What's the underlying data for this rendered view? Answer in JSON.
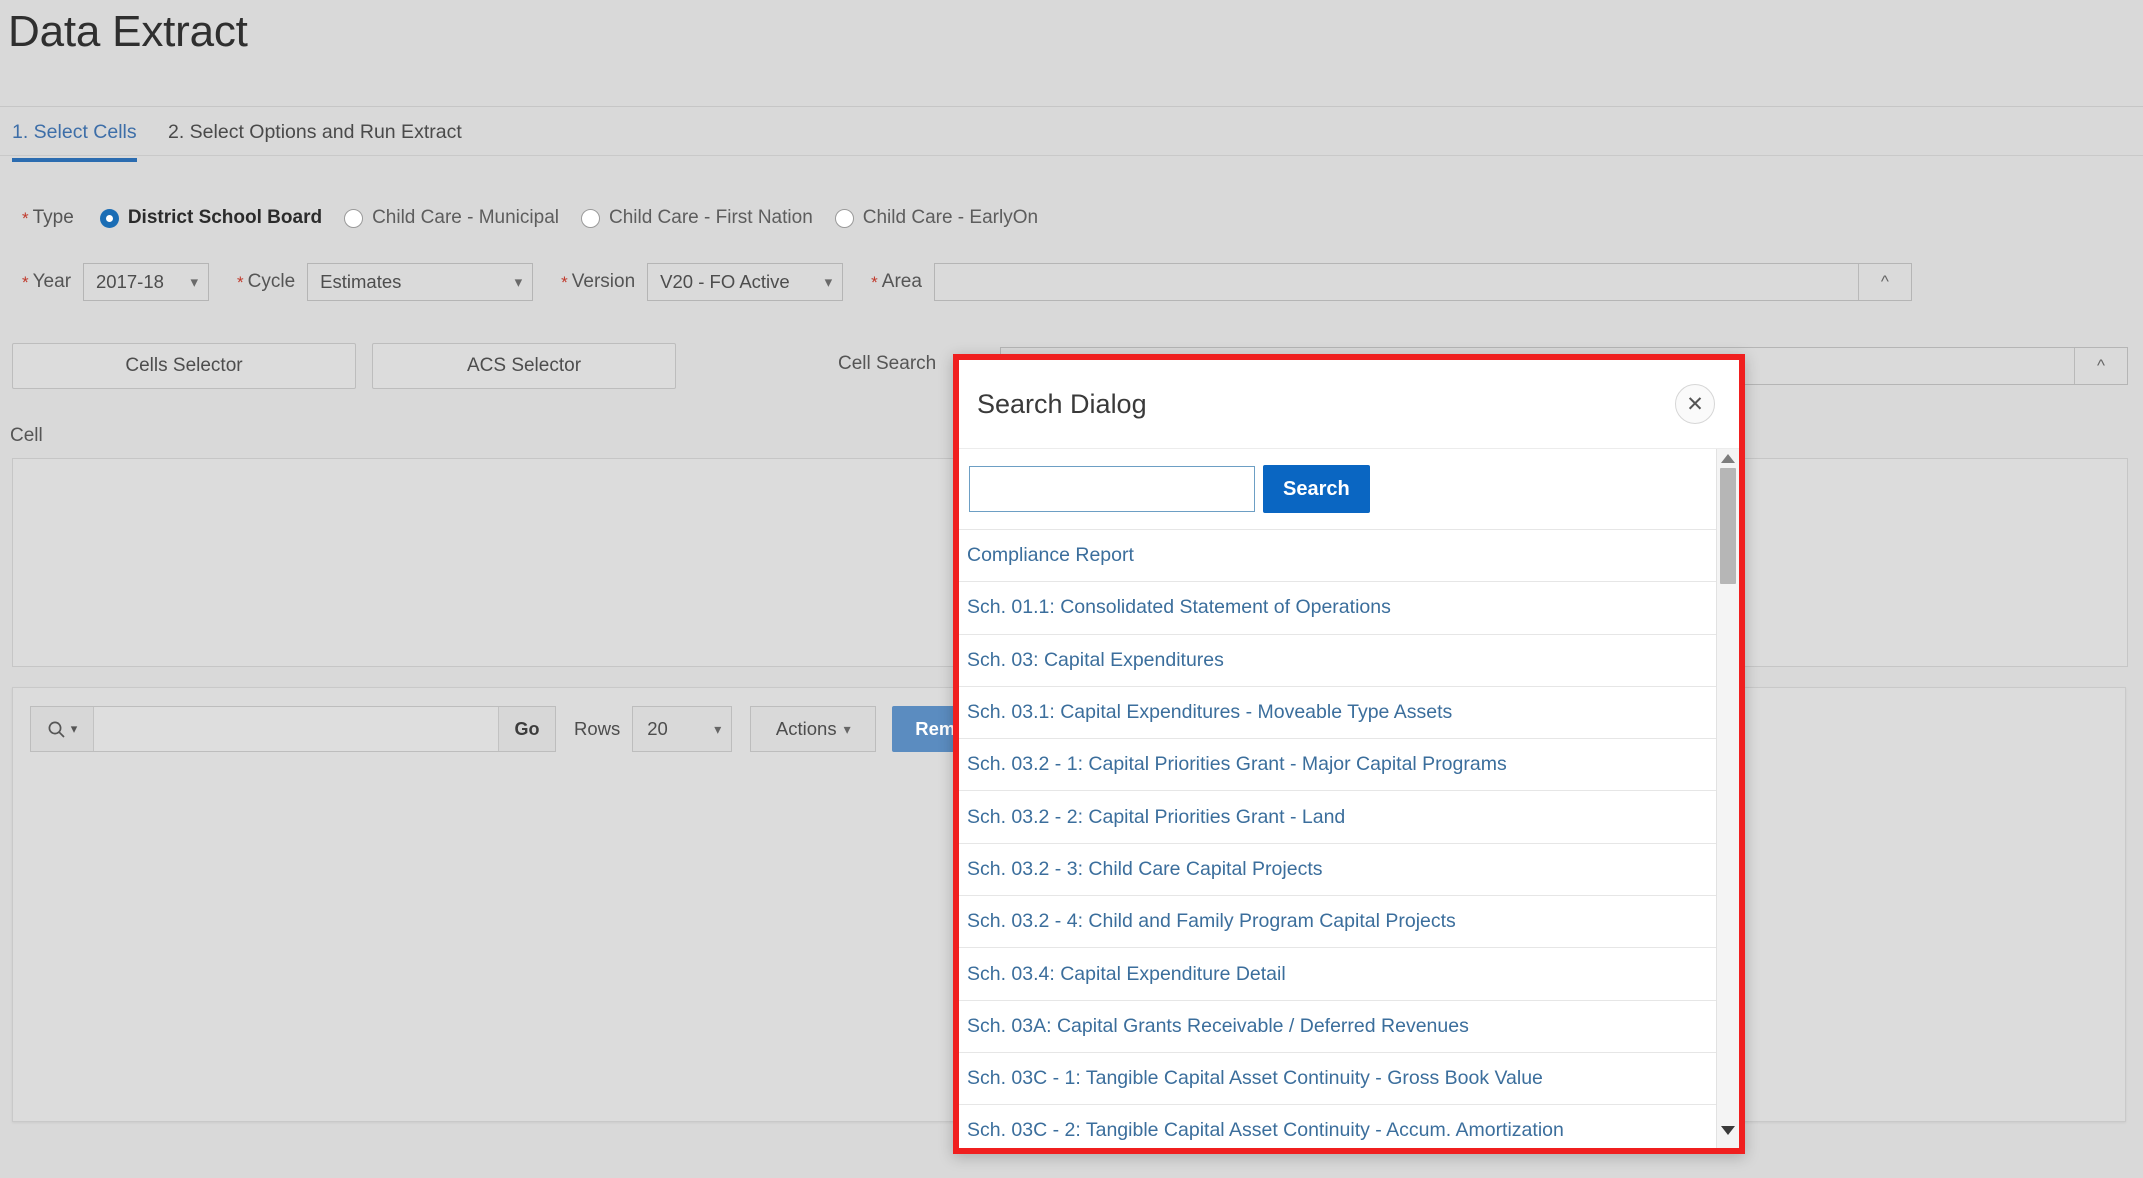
{
  "page": {
    "title": "Data Extract"
  },
  "tabs": [
    {
      "label": "1. Select Cells",
      "active": true
    },
    {
      "label": "2. Select Options and Run Extract",
      "active": false
    }
  ],
  "type_field": {
    "label": "Type",
    "required_marker": "*",
    "options": [
      {
        "label": "District School Board",
        "selected": true
      },
      {
        "label": "Child Care - Municipal",
        "selected": false
      },
      {
        "label": "Child Care - First Nation",
        "selected": false
      },
      {
        "label": "Child Care - EarlyOn",
        "selected": false
      }
    ]
  },
  "selects": {
    "year": {
      "label": "Year",
      "value": "2017-18",
      "required_marker": "*"
    },
    "cycle": {
      "label": "Cycle",
      "value": "Estimates",
      "required_marker": "*"
    },
    "version": {
      "label": "Version",
      "value": "V20 - FO Active",
      "required_marker": "*"
    },
    "area": {
      "label": "Area",
      "value": "",
      "placeholder": "",
      "required_marker": "*",
      "toggle_icon": "chevron-up-icon"
    }
  },
  "selector_buttons": {
    "cells_selector": "Cells Selector",
    "acs_selector": "ACS Selector"
  },
  "cell_search": {
    "label": "Cell Search",
    "value": "",
    "placeholder": "",
    "toggle_icon": "chevron-up-icon"
  },
  "cell_section": {
    "label": "Cell"
  },
  "report_toolbar": {
    "search_icon": "magnifier-icon",
    "search_value": "",
    "search_placeholder": "",
    "go_label": "Go",
    "rows_label": "Rows",
    "rows_value": "20",
    "actions_label": "Actions",
    "remove_label": "Remove"
  },
  "dialog": {
    "title": "Search Dialog",
    "close_icon": "close-icon",
    "search_value": "",
    "search_placeholder": "",
    "search_button": "Search",
    "highlight_color": "#f01f1f",
    "accent_color": "#0a66c2",
    "link_color": "#3b6e9c",
    "results": [
      "Compliance Report",
      "Sch. 01.1: Consolidated Statement of Operations",
      "Sch. 03: Capital Expenditures",
      "Sch. 03.1: Capital Expenditures - Moveable Type Assets",
      "Sch. 03.2 - 1: Capital Priorities Grant - Major Capital Programs",
      "Sch. 03.2 - 2: Capital Priorities Grant - Land",
      "Sch. 03.2 - 3: Child Care Capital Projects",
      "Sch. 03.2 - 4: Child and Family Program Capital Projects",
      "Sch. 03.4: Capital Expenditure Detail",
      "Sch. 03A: Capital Grants Receivable / Deferred Revenues",
      "Sch. 03C - 1: Tangible Capital Asset Continuity - Gross Book Value",
      "Sch. 03C - 2: Tangible Capital Asset Continuity - Accum. Amortization"
    ],
    "scrollbar": {
      "up_icon": "scroll-up-arrow-icon",
      "down_icon": "scroll-down-arrow-icon"
    }
  }
}
